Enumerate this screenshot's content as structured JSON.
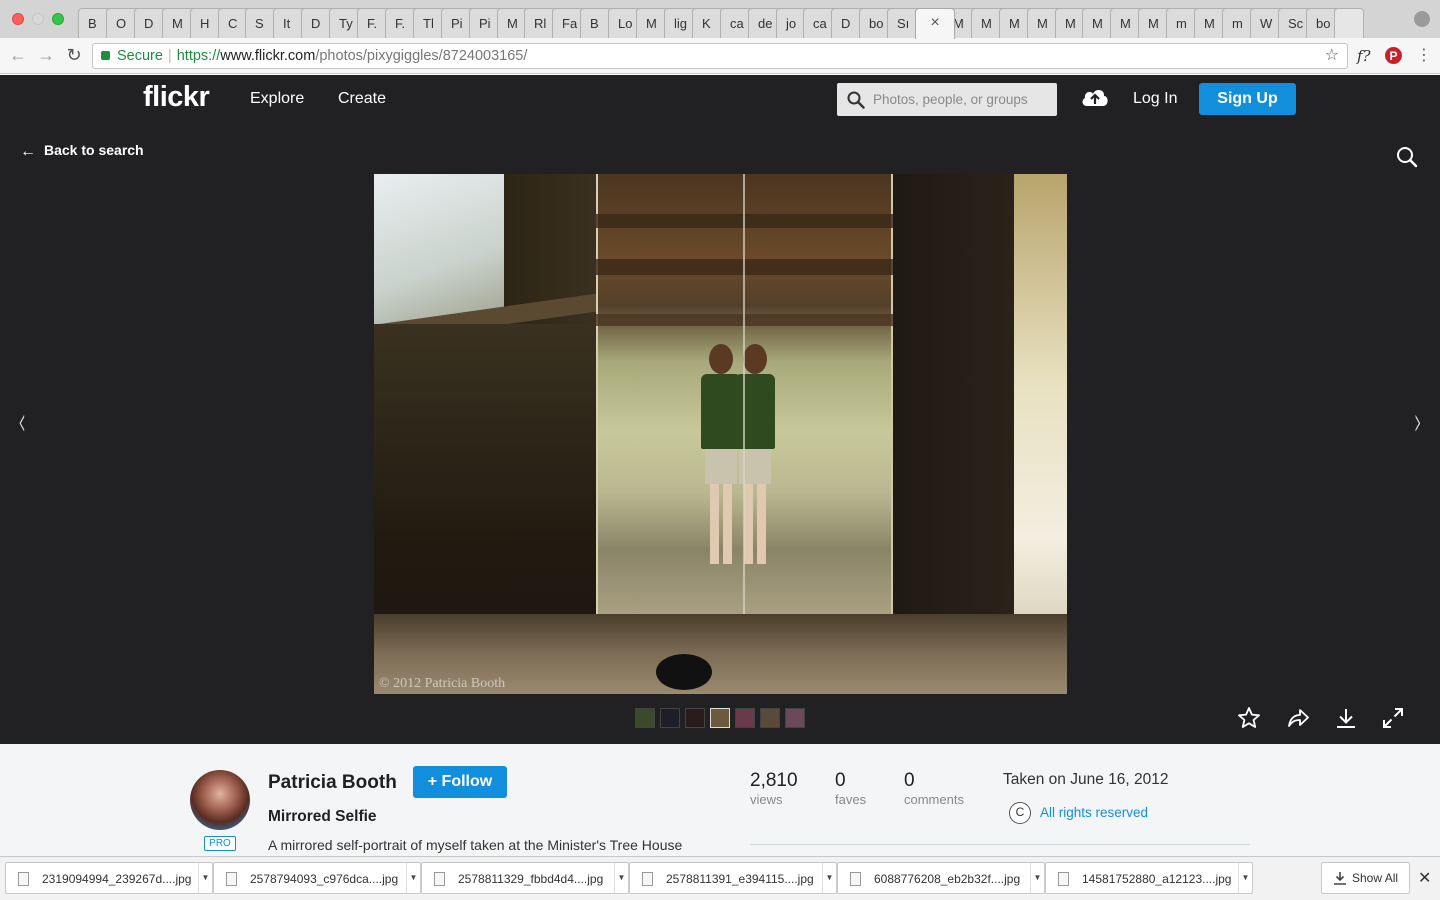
{
  "browser": {
    "tabs": [
      "B",
      "O",
      "D",
      "M",
      "H",
      "C",
      "S",
      "It",
      "D",
      "Ty",
      "F.",
      "F.",
      "Tl",
      "Pi",
      "Pi",
      "M",
      "Rl",
      "Fa",
      "B",
      "Lo",
      "M",
      "lig",
      "K",
      "ca",
      "de",
      "jo",
      "ca",
      "D",
      "bo",
      "Sı",
      "×",
      "M",
      "M",
      "M",
      "M",
      "M",
      "M",
      "M",
      "M",
      "m",
      "M",
      "m",
      "W",
      "Sc",
      "bo"
    ],
    "active_tab_close": "×",
    "secure_label": "Secure",
    "url_scheme": "https://",
    "url_host": "www.flickr.com",
    "url_path": "/photos/pixygiggles/8724003165/",
    "ext_f_label": "f?",
    "ext_p_label": "P"
  },
  "header": {
    "logo": "flickr",
    "nav": [
      "Explore",
      "Create"
    ],
    "search_placeholder": "Photos, people, or groups",
    "login": "Log In",
    "signup": "Sign Up"
  },
  "stage": {
    "back_label": "Back to search",
    "watermark": "© 2012 Patricia Booth",
    "thumbs": [
      {
        "color": "#3c4a2c"
      },
      {
        "color": "#1e1e26"
      },
      {
        "color": "#2a1c1c"
      },
      {
        "color": "#6b5a3c"
      },
      {
        "color": "#6a3a4a"
      },
      {
        "color": "#5a4a3c"
      },
      {
        "color": "#6a4a5a"
      }
    ],
    "active_thumb_index": 3
  },
  "info": {
    "author": "Patricia Booth",
    "pro_badge": "PRO",
    "follow_label": "+ Follow",
    "title": "Mirrored Selfie",
    "description": "A mirrored self-portrait of myself taken at the Minister's Tree House",
    "stats": [
      {
        "num": "2,810",
        "label": "views"
      },
      {
        "num": "0",
        "label": "faves"
      },
      {
        "num": "0",
        "label": "comments"
      }
    ],
    "taken": "Taken on June 16, 2012",
    "license_icon": "C",
    "license": "All rights reserved"
  },
  "downloads": {
    "items": [
      "2319094994_239267d....jpg",
      "2578794093_c976dca....jpg",
      "2578811329_fbbd4d4....jpg",
      "2578811391_e394115....jpg",
      "6088776208_eb2b32f....jpg",
      "14581752880_a12123....jpg"
    ],
    "show_all": "Show All"
  },
  "colors": {
    "flickr_blue": "#128fdc",
    "header_bg": "#212124",
    "secure_green": "#1e8e3e"
  }
}
